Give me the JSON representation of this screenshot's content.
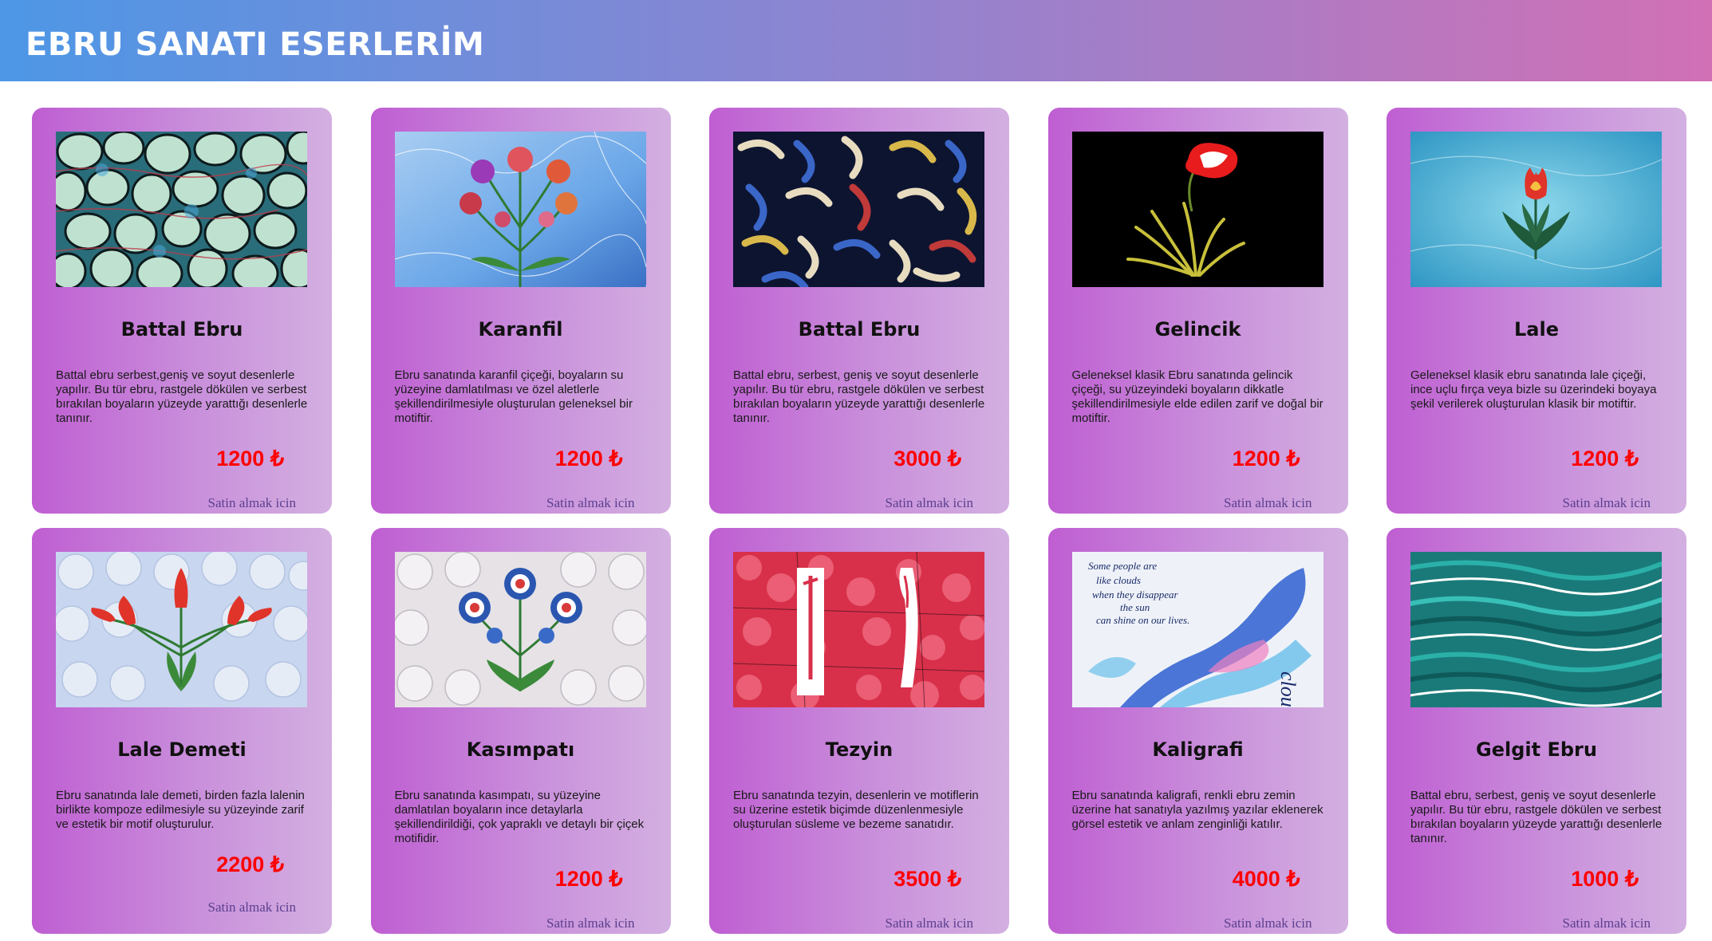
{
  "header": {
    "title": "EBRU SANATI ESERLERİM"
  },
  "cards": [
    {
      "title": "Battal Ebru",
      "description": "Battal ebru serbest,geniş ve soyut desenlerle yapılır. Bu tür ebru, rastgele dökülen ve serbest bırakılan boyaların yüzeyde yarattığı desenlerle tanınır.",
      "price": "1200 ₺",
      "buy": "Satin almak icin",
      "image": "battal-ebru-green-marble-image"
    },
    {
      "title": "Karanfil",
      "description": "Ebru sanatında karanfil çiçeği, boyaların su yüzeyine damlatılması ve özel aletlerle şekillendirilmesiyle oluşturulan geleneksel bir motiftir.",
      "price": "1200 ₺",
      "buy": "Satin almak icin",
      "image": "carnation-flowers-image"
    },
    {
      "title": "Battal Ebru",
      "description": "Battal ebru, serbest, geniş ve soyut desenlerle yapılır. Bu tür ebru, rastgele dökülen ve serbest bırakılan boyaların yüzeyde yarattığı desenlerle tanınır.",
      "price": "3000 ₺",
      "buy": "Satin almak icin",
      "image": "battal-ebru-dark-swirls-image"
    },
    {
      "title": "Gelincik",
      "description": "Geleneksel klasik Ebru sanatında gelincik çiçeği, su yüzeyindeki boyaların dikkatle şekillendirilmesiyle elde edilen zarif ve doğal bir motiftir.",
      "price": "1200 ₺",
      "buy": "Satin almak icin",
      "image": "poppy-on-black-image"
    },
    {
      "title": "Lale",
      "description": "Geleneksel klasik ebru sanatında lale çiçeği, ince uçlu fırça veya bizle su üzerindeki boyaya şekil verilerek oluşturulan klasik bir motiftir.",
      "price": "1200 ₺",
      "buy": "Satin almak icin",
      "image": "tulip-on-blue-image"
    },
    {
      "title": "Lale Demeti",
      "description": "Ebru sanatında lale demeti, birden fazla lalenin birlikte kompoze edilmesiyle su yüzeyinde zarif ve estetik bir motif oluşturulur.",
      "price": "2200 ₺",
      "buy": "Satin almak icin",
      "image": "tulip-bouquet-image"
    },
    {
      "title": "Kasımpatı",
      "description": "Ebru sanatında kasımpatı, su yüzeyine damlatılan boyaların ince detaylarla şekillendirildiği, çok yapraklı ve detaylı bir çiçek motifidir.",
      "price": "1200 ₺",
      "buy": "Satin almak icin",
      "image": "chrysanthemum-image"
    },
    {
      "title": "Tezyin",
      "description": "Ebru sanatında tezyin, desenlerin ve motiflerin su üzerine estetik biçimde düzenlenmesiyle oluşturulan süsleme ve bezeme sanatıdır.",
      "price": "3500 ₺",
      "buy": "Satin almak icin",
      "image": "tezyin-red-calligraphy-image"
    },
    {
      "title": "Kaligrafi",
      "description": "Ebru sanatında kaligrafi, renkli ebru zemin üzerine hat sanatıyla yazılmış yazılar eklenerek görsel estetik ve anlam zenginliği katılır.",
      "price": "4000 ₺",
      "buy": "Satin almak icin",
      "image": "calligraphy-blue-ink-image"
    },
    {
      "title": "Gelgit Ebru",
      "description": "Battal ebru, serbest, geniş ve soyut desenlerle yapılır. Bu tür ebru, rastgele dökülen ve serbest bırakılan boyaların yüzeyde yarattığı desenlerle tanınır.",
      "price": "1000 ₺",
      "buy": "Satin almak icin",
      "image": "gelgit-teal-waves-image"
    }
  ],
  "kaligrafi_text": {
    "line1": "Some people are",
    "line2": "like clouds",
    "line3": "when they disappear",
    "line4": "the sun",
    "line5": "can shine on our lives.",
    "side": "clouds"
  }
}
